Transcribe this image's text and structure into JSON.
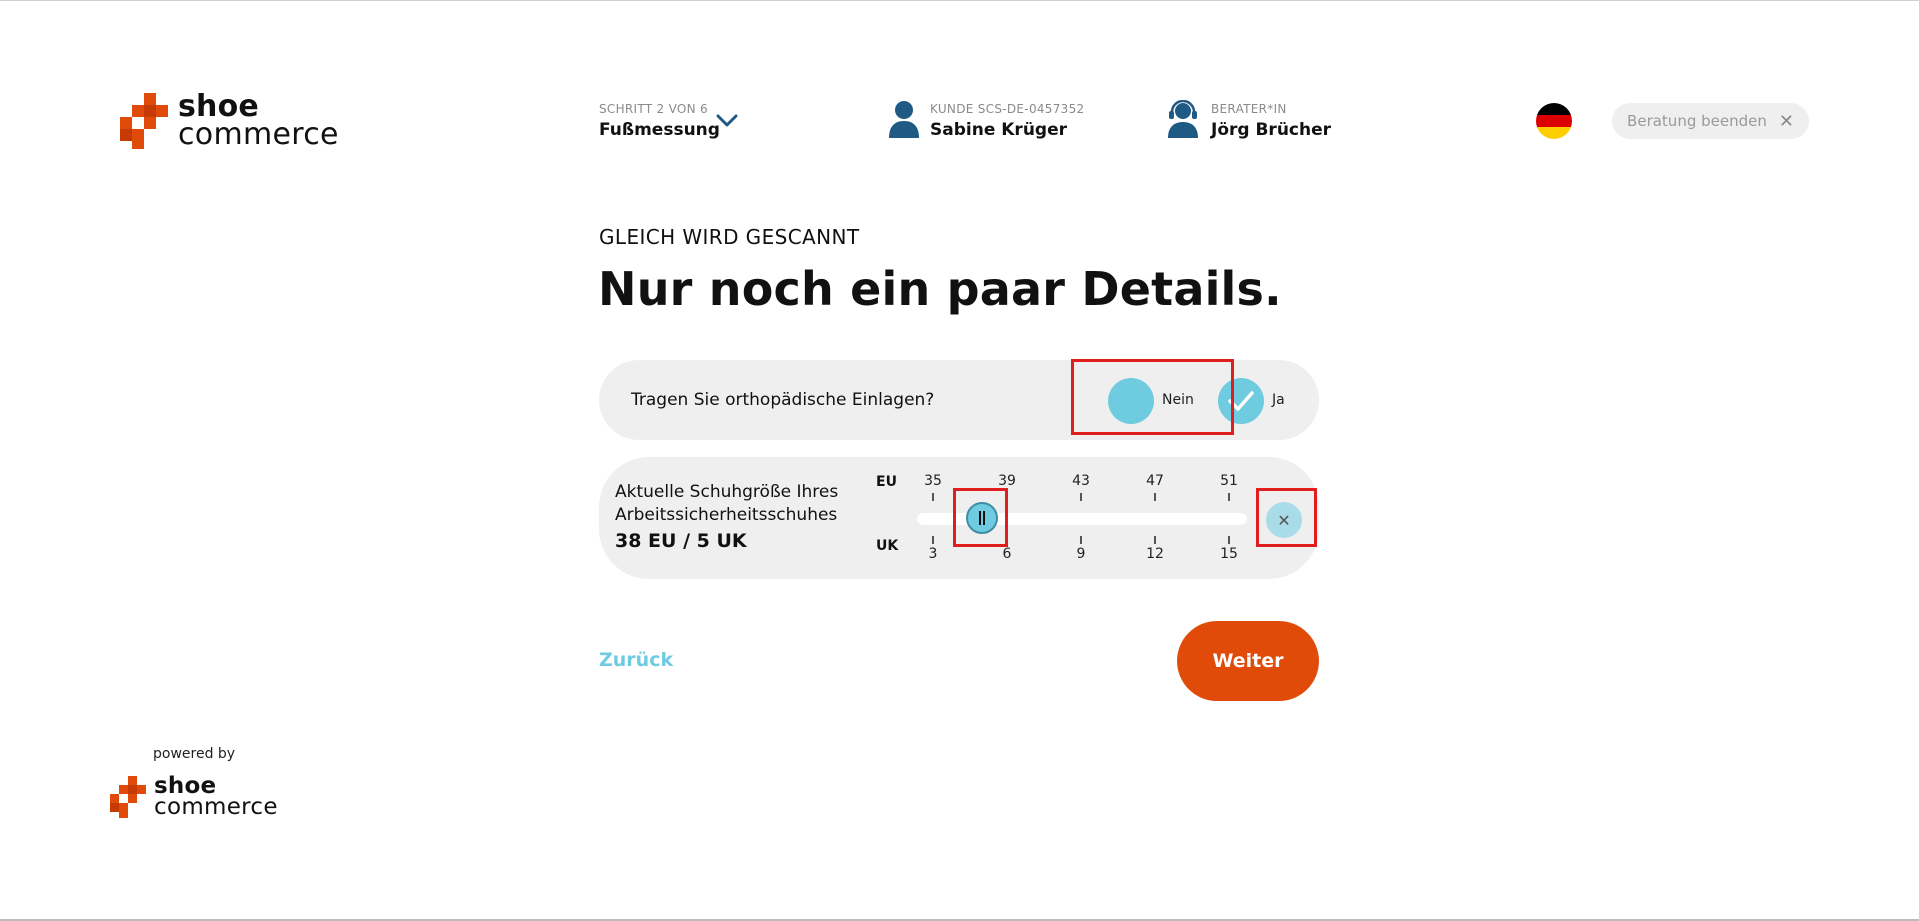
{
  "brand": {
    "logo_line1": "shoe",
    "logo_line2": "commerce",
    "color_orange": "#e04b0a",
    "color_accent": "#6fcbe0"
  },
  "header": {
    "step_small": "SCHRITT 2 VON 6",
    "step_name": "Fußmessung",
    "customer_small": "KUNDE SCS-DE-0457352",
    "customer_name": "Sabine Krüger",
    "advisor_small": "BERATER*IN",
    "advisor_name": "Jörg Brücher",
    "language_icon": "flag-de-icon",
    "end_label": "Beratung beenden"
  },
  "main": {
    "subtitle": "GLEICH WIRD GESCANNT",
    "title": "Nur noch ein paar Details.",
    "question1": {
      "label": "Tragen Sie orthopädische Einlagen?",
      "option_no": "Nein",
      "option_yes": "Ja",
      "selected": "Ja"
    },
    "size": {
      "label_line1": "Aktuelle Schuhgröße Ihres",
      "label_line2": "Arbeitssicherheitsschuhes",
      "value": "38 EU / 5 UK",
      "eu_label": "EU",
      "uk_label": "UK",
      "eu_ticks": [
        "35",
        "39",
        "43",
        "47",
        "51"
      ],
      "uk_ticks": [
        "3",
        "6",
        "9",
        "12",
        "15"
      ]
    },
    "back_label": "Zurück",
    "next_label": "Weiter"
  },
  "footer": {
    "powered_by": "powered by",
    "logo_line1": "shoe",
    "logo_line2": "commerce"
  }
}
